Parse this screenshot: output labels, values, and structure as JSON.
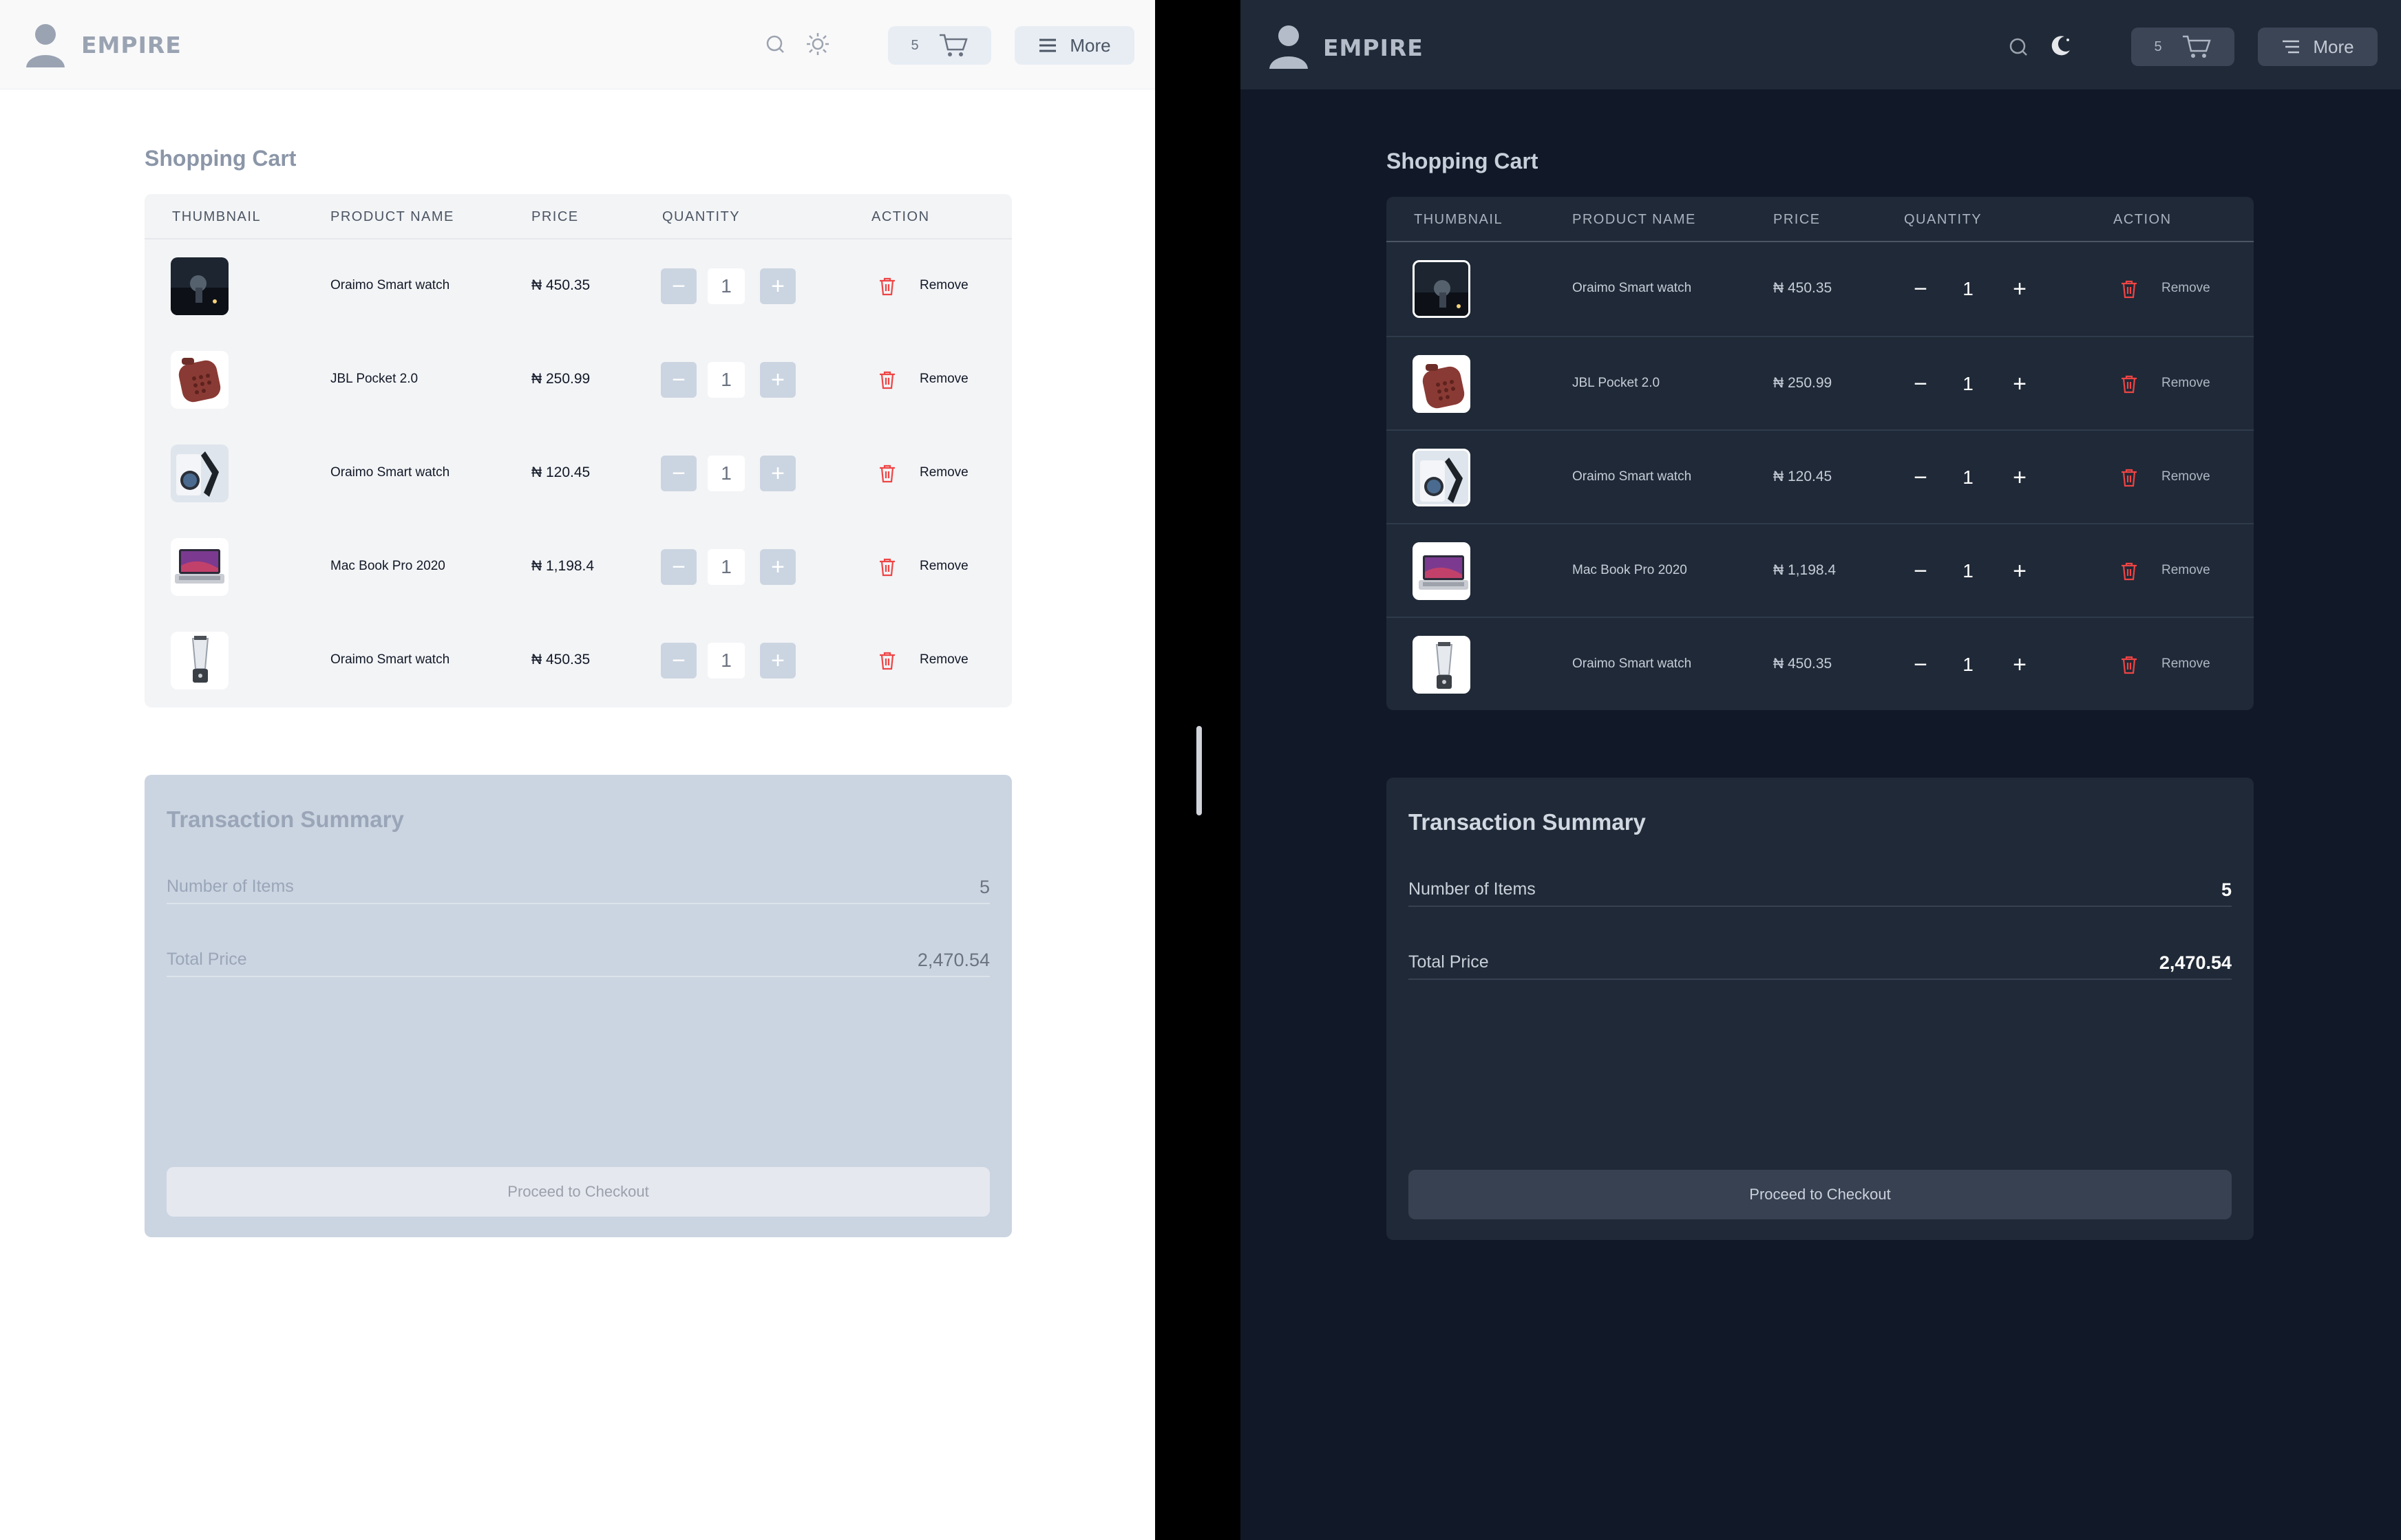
{
  "brand": "EMPIRE",
  "header": {
    "cart_count": "5",
    "more_label": "More"
  },
  "cart": {
    "title": "Shopping Cart",
    "columns": [
      "THUMBNAIL",
      "PRODUCT NAME",
      "PRICE",
      "QUANTITY",
      "ACTION"
    ],
    "rows": [
      {
        "name": "Oraimo Smart watch",
        "price": "₦ 450.35",
        "qty": "1",
        "thumb": "dark-photo"
      },
      {
        "name": "JBL Pocket 2.0",
        "price": "₦ 250.99",
        "qty": "1",
        "thumb": "red-speaker"
      },
      {
        "name": "Oraimo Smart watch",
        "price": "₦ 120.45",
        "qty": "1",
        "thumb": "watch-box"
      },
      {
        "name": "Mac Book Pro 2020",
        "price": "₦ 1,198.4",
        "qty": "1",
        "thumb": "laptop"
      },
      {
        "name": "Oraimo Smart watch",
        "price": "₦ 450.35",
        "qty": "1",
        "thumb": "blender"
      }
    ],
    "remove_label": "Remove"
  },
  "summary": {
    "title": "Transaction Summary",
    "items_label": "Number of Items",
    "items_value": "5",
    "total_label": "Total Price",
    "total_value": "2,470.54",
    "checkout_label": "Proceed to Checkout"
  },
  "themes": {
    "light": {
      "theme_icon": "sun-icon"
    },
    "dark": {
      "theme_icon": "moon-icon"
    }
  },
  "colors": {
    "remove_red": "#ef4444",
    "dark_bg": "#111827",
    "dark_card": "#1f2937",
    "light_summary": "#cbd5e1"
  }
}
